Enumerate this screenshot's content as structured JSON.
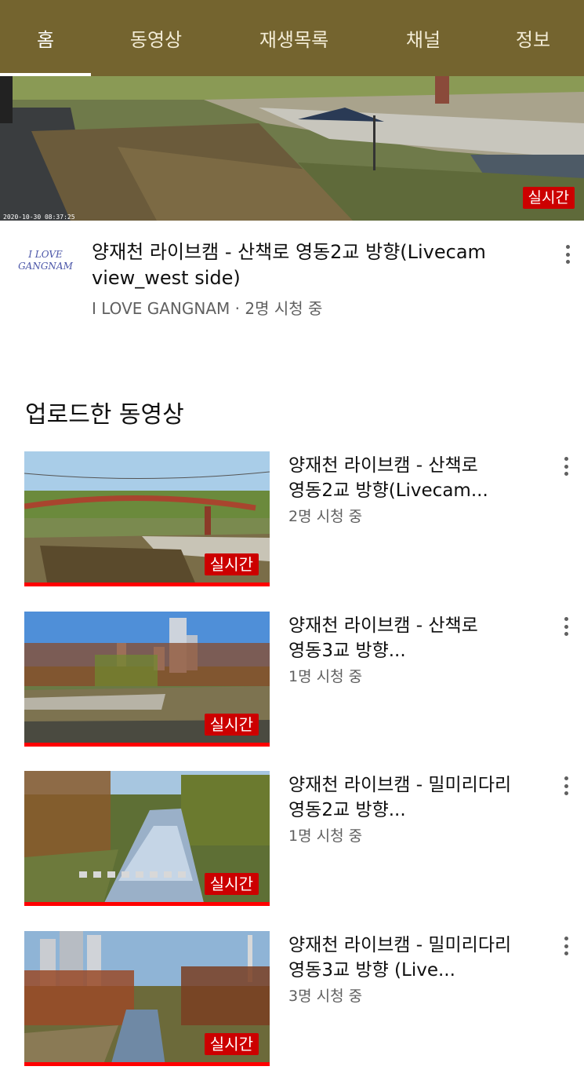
{
  "tabs": [
    {
      "label": "홈",
      "active": true
    },
    {
      "label": "동영상",
      "active": false
    },
    {
      "label": "재생목록",
      "active": false
    },
    {
      "label": "채널",
      "active": false
    },
    {
      "label": "정보",
      "active": false
    }
  ],
  "featured": {
    "live_badge": "실시간",
    "timestamp": "2020-10-30 08:37:25",
    "avatar_line1": "I LOVE",
    "avatar_line2": "GANGNAM",
    "title_line1": "양재천 라이브캠 - 산책로 영동2교 방향(Livecam",
    "title_line2": "view_west side)",
    "subtitle": "I LOVE GANGNAM · 2명 시청 중"
  },
  "section": {
    "title": "업로드한 동영상"
  },
  "videos": [
    {
      "title_line1": "양재천 라이브캠 - 산책로",
      "title_line2": "영동2교 방향(Livecam...",
      "viewers": "2명 시청 중",
      "badge": "실시간"
    },
    {
      "title_line1": "양재천 라이브캠 - 산책로",
      "title_line2": "영동3교 방향...",
      "viewers": "1명 시청 중",
      "badge": "실시간"
    },
    {
      "title_line1": "양재천 라이브캠 - 밀미리다리",
      "title_line2": "영동2교 방향...",
      "viewers": "1명 시청 중",
      "badge": "실시간"
    },
    {
      "title_line1": "양재천  라이브캠 - 밀미리다리",
      "title_line2": "영동3교 방향 (Live...",
      "viewers": "3명 시청 중",
      "badge": "실시간"
    }
  ],
  "colors": {
    "tabbar_bg": "#74642f",
    "live_red": "#cc0000",
    "progress_red": "#ff0000",
    "secondary_text": "#606060"
  },
  "icons": {
    "more": "more-vert-icon"
  }
}
